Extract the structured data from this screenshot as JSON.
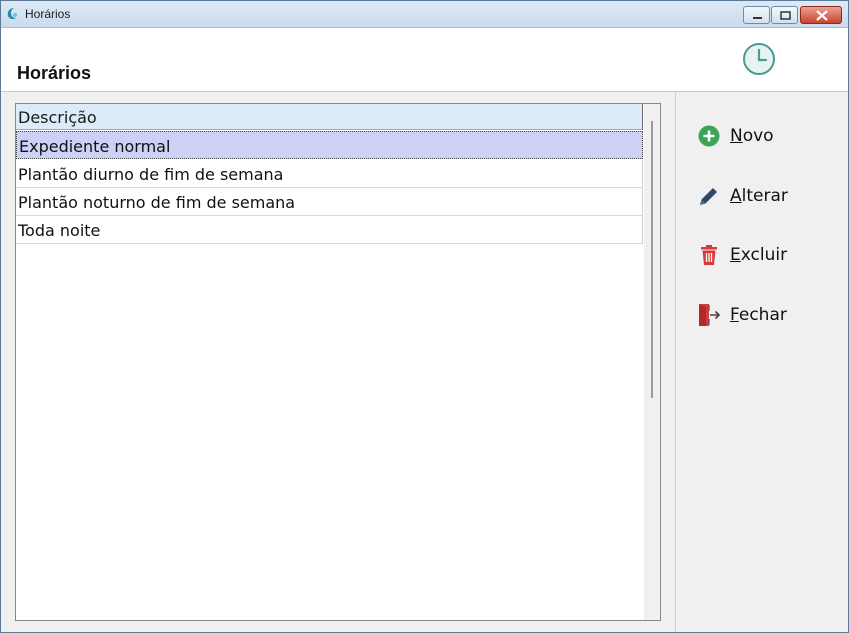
{
  "window": {
    "title": "Horários"
  },
  "header": {
    "title": "Horários",
    "icon": "clock-icon"
  },
  "list": {
    "column_header": "Descrição",
    "rows": [
      {
        "label": "Expediente normal",
        "selected": true
      },
      {
        "label": "Plantão diurno de fim de semana",
        "selected": false
      },
      {
        "label": "Plantão noturno de fim de semana",
        "selected": false
      },
      {
        "label": "Toda noite",
        "selected": false
      }
    ]
  },
  "actions": [
    {
      "accel": "N",
      "rest": "ovo",
      "label": "Novo",
      "icon": "plus-circle-icon",
      "color": "#3aa655"
    },
    {
      "accel": "A",
      "rest": "lterar",
      "label": "Alterar",
      "icon": "pencil-icon",
      "color": "#2a4a66"
    },
    {
      "accel": "E",
      "rest": "xcluir",
      "label": "Excluir",
      "icon": "trash-icon",
      "color": "#d63a3a"
    },
    {
      "accel": "F",
      "rest": "echar",
      "label": "Fechar",
      "icon": "exit-door-icon",
      "color": "#d63a3a"
    }
  ],
  "colors": {
    "selection": "#ccd1f6",
    "header_bg": "#ddeaf9"
  }
}
